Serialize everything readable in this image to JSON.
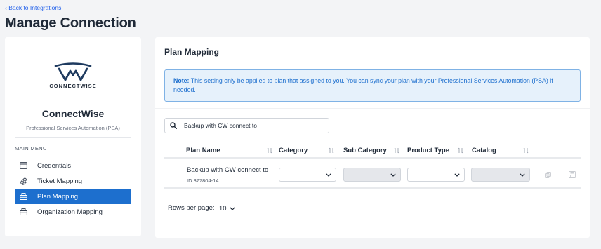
{
  "header": {
    "back_link": "‹ Back to Integrations",
    "title": "Manage Connection"
  },
  "sidebar": {
    "logo_text": "CONNECTWISE",
    "brand_name": "ConnectWise",
    "brand_subtitle": "Professional Services Automation (PSA)",
    "menu_heading": "MAIN MENU",
    "items": [
      {
        "label": "Credentials",
        "icon": "credentials-icon",
        "active": false
      },
      {
        "label": "Ticket Mapping",
        "icon": "paperclip-icon",
        "active": false
      },
      {
        "label": "Plan Mapping",
        "icon": "plan-icon",
        "active": true
      },
      {
        "label": "Organization Mapping",
        "icon": "organization-icon",
        "active": false
      }
    ]
  },
  "main": {
    "title": "Plan Mapping",
    "note_label": "Note:",
    "note_text": " This setting only be applied to plan that assigned to you. You can sync your plan with your Professional Services Automation (PSA) if needed.",
    "search": {
      "value": "Backup with CW connect to",
      "placeholder": "Search"
    },
    "table": {
      "columns": [
        "Plan Name",
        "Category",
        "Sub Category",
        "Product Type",
        "Catalog"
      ],
      "rows": [
        {
          "plan_name": "Backup with CW connect to",
          "plan_id": "ID 377804-14",
          "category": "",
          "sub_category": "",
          "product_type": "",
          "catalog": ""
        }
      ]
    },
    "pagination": {
      "rows_per_page_label": "Rows per page:",
      "rows_per_page_value": "10"
    }
  },
  "colors": {
    "accent": "#1d6fce",
    "note_bg": "#e6f1fb",
    "note_border": "#7fb2e5",
    "page_bg": "#f3f4f6"
  }
}
